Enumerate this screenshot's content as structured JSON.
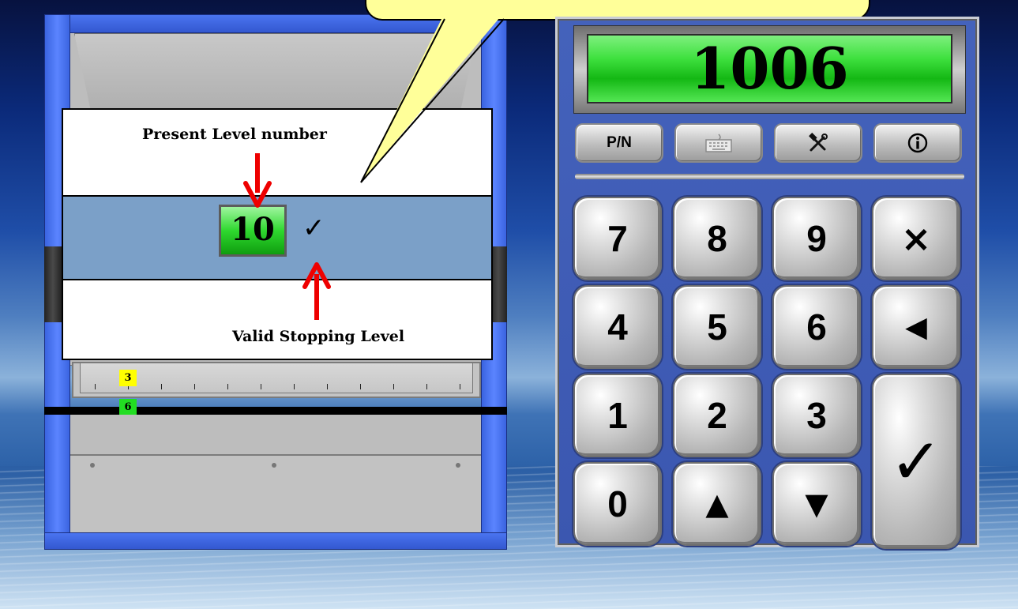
{
  "callout": {
    "present_level_label": "Present Level number",
    "valid_stopping_label": "Valid Stopping Level",
    "level_value": "10",
    "check_glyph": "✓"
  },
  "ruler": {
    "upper_level": "3",
    "lower_level": "6"
  },
  "keypad": {
    "display_value": "1006",
    "func_buttons": {
      "pn": "P/N",
      "keyboard": "keyboard-icon",
      "tools": "tools-icon",
      "info": "info-icon"
    },
    "keys": {
      "k7": "7",
      "k8": "8",
      "k9": "9",
      "clear": "×",
      "k4": "4",
      "k5": "5",
      "k6": "6",
      "back": "◀",
      "k1": "1",
      "k2": "2",
      "k3": "3",
      "enter": "✓",
      "k0": "0",
      "up": "▲",
      "down": "▼"
    }
  },
  "colors": {
    "display_green": "#2fd82f",
    "keypad_blue": "#3b57b0",
    "bubble_yellow": "#ffff99",
    "arrow_red": "#ee0000"
  }
}
